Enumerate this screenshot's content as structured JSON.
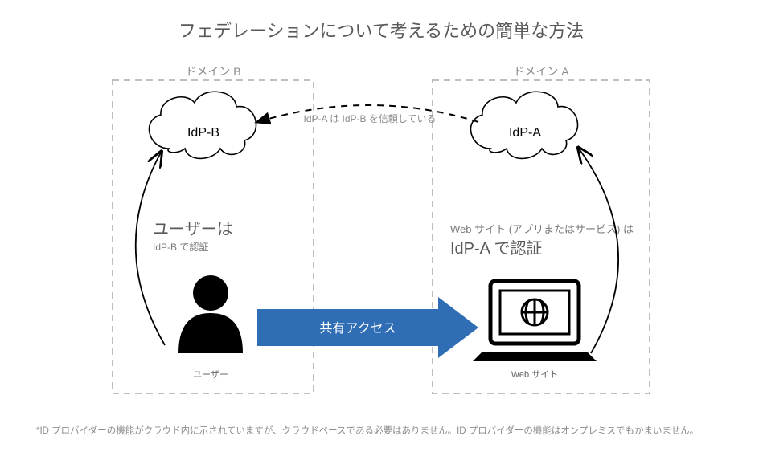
{
  "title": "フェデレーションについて考えるための簡単な方法",
  "domainB": {
    "label": "ドメイン B",
    "idp": "IdP-B",
    "userHeading": "ユーザーは",
    "userAuth": "IdP-B で認証",
    "userCaption": "ユーザー"
  },
  "domainA": {
    "label": "ドメイン A",
    "idp": "IdP-A",
    "siteHeading": "Web サイト (アプリまたはサービス) は",
    "siteAuth": "IdP-A で認証",
    "siteCaption": "Web サイト"
  },
  "trust": "IdP-A は IdP-B を信頼している",
  "share": "共有アクセス",
  "footnote": "*ID プロバイダーの機能がクラウド内に示されていますが、クラウドベースである必要はありません。ID プロバイダーの機能はオンプレミスでもかまいません。"
}
